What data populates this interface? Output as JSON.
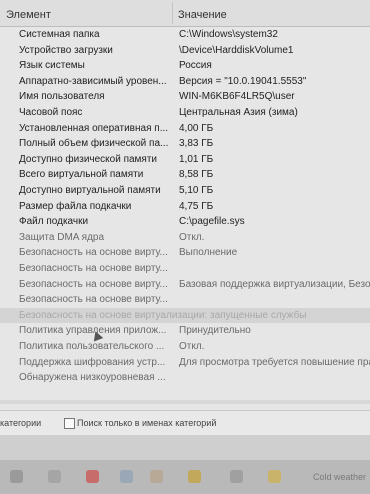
{
  "table": {
    "col_name": "Элемент",
    "col_value": "Значение",
    "rows": [
      {
        "name": "Системная папка",
        "value": "C:\\Windows\\system32"
      },
      {
        "name": "Устройство загрузки",
        "value": "\\Device\\HarddiskVolume1"
      },
      {
        "name": "Язык системы",
        "value": "Россия"
      },
      {
        "name": "Аппаратно-зависимый уровен...",
        "value": "Версия = \"10.0.19041.5553\""
      },
      {
        "name": "Имя пользователя",
        "value": "WIN-M6KB6F4LR5Q\\user"
      },
      {
        "name": "Часовой пояс",
        "value": "Центральная Азия (зима)"
      },
      {
        "name": "Установленная оперативная п...",
        "value": "4,00 ГБ"
      },
      {
        "name": "Полный объем физической па...",
        "value": "3,83 ГБ"
      },
      {
        "name": "Доступно физической памяти",
        "value": "1,01 ГБ"
      },
      {
        "name": "Всего виртуальной памяти",
        "value": "8,58 ГБ"
      },
      {
        "name": "Доступно виртуальной памяти",
        "value": "5,10 ГБ"
      },
      {
        "name": "Размер файла подкачки",
        "value": "4,75 ГБ"
      },
      {
        "name": "Файл подкачки",
        "value": "C:\\pagefile.sys"
      },
      {
        "name": "Защита DMA ядра",
        "value": "Откл."
      },
      {
        "name": "Безопасность на основе вирту...",
        "value": "Выполнение"
      },
      {
        "name": "Безопасность на основе вирту...",
        "value": ""
      },
      {
        "name": "Безопасность на основе вирту...",
        "value": "Базовая поддержка виртуализации, Безопа"
      },
      {
        "name": "Безопасность на основе вирту...",
        "value": ""
      },
      {
        "name": "Безопасность на основе виртуализации: запущенные службы",
        "value": ""
      },
      {
        "name": "Политика управления прилож...",
        "value": "Принудительно"
      },
      {
        "name": "Политика пользовательского ...",
        "value": "Откл."
      },
      {
        "name": "Поддержка шифрования устр...",
        "value": "Для просмотра требуется повышение прав"
      },
      {
        "name": "Обнаружена низкоуровневая ...",
        "value": ""
      }
    ]
  },
  "bottom": {
    "categories_label": "категории",
    "search_names_label": "Поиск только в именах категорий"
  },
  "taskbar": {
    "weather_text": "Cold weather",
    "icons": [
      "search-icon",
      "task-view-icon",
      "youtube-icon",
      "app-icon",
      "app-icon",
      "chrome-icon",
      "app-icon",
      "folder-icon"
    ]
  }
}
